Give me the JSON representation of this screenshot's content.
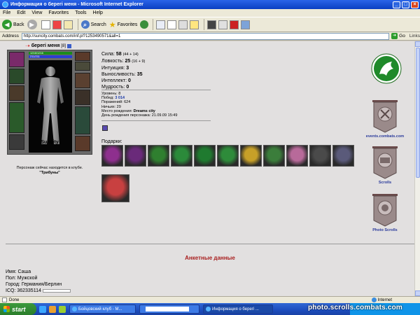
{
  "window": {
    "title": "Информация о берегі меня - Microsoft Internet Explorer",
    "min": "_",
    "max": "□",
    "close": "×"
  },
  "menu": [
    "File",
    "Edit",
    "View",
    "Favorites",
    "Tools",
    "Help"
  ],
  "toolbar": {
    "back": "Back",
    "search": "Search",
    "favorites": "Favorites"
  },
  "address": {
    "label": "Address",
    "url": "http://suncity.combats.com/inf.pl?1253490571&all=1",
    "go": "Go",
    "links": "Links"
  },
  "character": {
    "name": "берегі меня",
    "level_badge": "[8]",
    "hp": "1216/1216",
    "mp": "211/211",
    "city": "Suncity",
    "location_line1": "Персонаж сейчас находится в клубе.",
    "location_line2": "\"Трибуны\""
  },
  "stats": [
    {
      "label": "Сила:",
      "value": "58",
      "extra": "(44 + 14)"
    },
    {
      "label": "Ловкость:",
      "value": "25",
      "extra": "(16 + 9)"
    },
    {
      "label": "Интуиция:",
      "value": "3",
      "extra": ""
    },
    {
      "label": "Выносливость:",
      "value": "35",
      "extra": ""
    },
    {
      "label": "Интеллект:",
      "value": "0",
      "extra": ""
    },
    {
      "label": "Мудрость:",
      "value": "0",
      "extra": ""
    }
  ],
  "record": {
    "level_label": "Уровень:",
    "level": "8",
    "wins_label": "Побед:",
    "wins": "3 014",
    "losses_label": "Поражений:",
    "losses": "624",
    "draws_label": "Ничьих:",
    "draws": "29",
    "birthplace_label": "Место рождения:",
    "birthplace": "Dreams city",
    "birthday_label": "День рождения персонажа:",
    "birthday": "21.09.09 15:49"
  },
  "gifts_label": "Подарки:",
  "gifts_row1": [
    {
      "icon": "target-gift-icon",
      "color": "#8e2f8e"
    },
    {
      "icon": "bullseye-gift-icon",
      "color": "#6a2a7a"
    },
    {
      "icon": "spiral-gift-icon",
      "color": "#2f7f2f"
    },
    {
      "icon": "green-shield-gift-icon",
      "color": "#2b8a3a"
    },
    {
      "icon": "green-banner-gift-icon",
      "color": "#1f7a2f"
    },
    {
      "icon": "green-leaf-gift-icon",
      "color": "#2e8b3a"
    },
    {
      "icon": "bell-gift-icon",
      "color": "#c7a028"
    },
    {
      "icon": "frog-gift-icon",
      "color": "#3b7d3b"
    },
    {
      "icon": "doll-gift-icon",
      "color": "#b86a9a"
    },
    {
      "icon": "mace-gift-icon",
      "color": "#4a4a4a"
    },
    {
      "icon": "badge-gift-icon",
      "color": "#5a5a7a"
    }
  ],
  "gifts_row2": [
    {
      "icon": "scroll-gift-icon",
      "color": "#c84040"
    }
  ],
  "side_links": [
    {
      "name": "events-link",
      "label": "events.combats.com"
    },
    {
      "name": "scrolls-link",
      "label": "Scrolls"
    },
    {
      "name": "photo-scrolls-link",
      "label": "Photo Scrolls"
    }
  ],
  "anketa": {
    "title": "Анкетные данные",
    "name_label": "Имя:",
    "name": "Саша",
    "gender_label": "Пол:",
    "gender": "Мужской",
    "city_label": "Город:",
    "city": "Германия/Берлин",
    "icq_label": "ICQ:",
    "icq": "362335114"
  },
  "status": {
    "text": "Done",
    "zone": "Internet"
  },
  "taskbar": {
    "start": "start",
    "task1": "Бойцовский клуб - M...",
    "task3": "Информация о берегі ..."
  },
  "watermark": "photo.scrolls.combats.com"
}
